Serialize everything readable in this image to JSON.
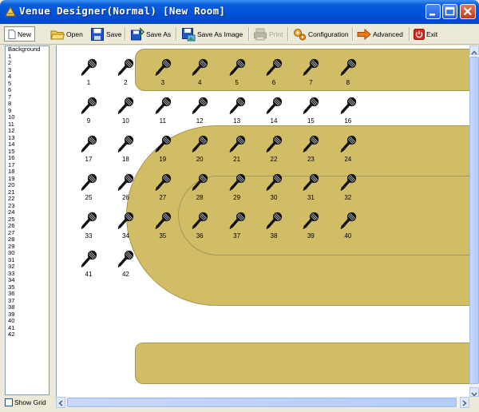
{
  "window": {
    "title": "Venue Designer(Normal) [New Room]",
    "minimize_icon": "minimize-icon",
    "maximize_icon": "maximize-icon",
    "close_icon": "close-icon"
  },
  "toolbar": {
    "new": "New",
    "open": "Open",
    "save": "Save",
    "save_as": "Save As",
    "save_as_image": "Save As Image",
    "print": "Print",
    "configuration": "Configuration",
    "advanced": "Advanced",
    "exit": "Exit"
  },
  "left_list": {
    "items": [
      "Background",
      "1",
      "2",
      "3",
      "4",
      "5",
      "6",
      "7",
      "8",
      "9",
      "10",
      "11",
      "12",
      "13",
      "14",
      "15",
      "16",
      "17",
      "18",
      "19",
      "20",
      "21",
      "22",
      "23",
      "24",
      "25",
      "26",
      "27",
      "28",
      "29",
      "30",
      "31",
      "32",
      "33",
      "34",
      "35",
      "36",
      "37",
      "38",
      "39",
      "40",
      "41",
      "42"
    ]
  },
  "show_grid_label": "Show Grid",
  "show_grid_checked": false,
  "microphones": [
    "1",
    "2",
    "3",
    "4",
    "5",
    "6",
    "7",
    "8",
    "9",
    "10",
    "11",
    "12",
    "13",
    "14",
    "15",
    "16",
    "17",
    "18",
    "19",
    "20",
    "21",
    "22",
    "23",
    "24",
    "25",
    "26",
    "27",
    "28",
    "29",
    "30",
    "31",
    "32",
    "33",
    "34",
    "35",
    "36",
    "37",
    "38",
    "39",
    "40",
    "41",
    "42"
  ],
  "colors": {
    "table_fill": "#d2bd67",
    "title_bar": "#0250d6"
  }
}
